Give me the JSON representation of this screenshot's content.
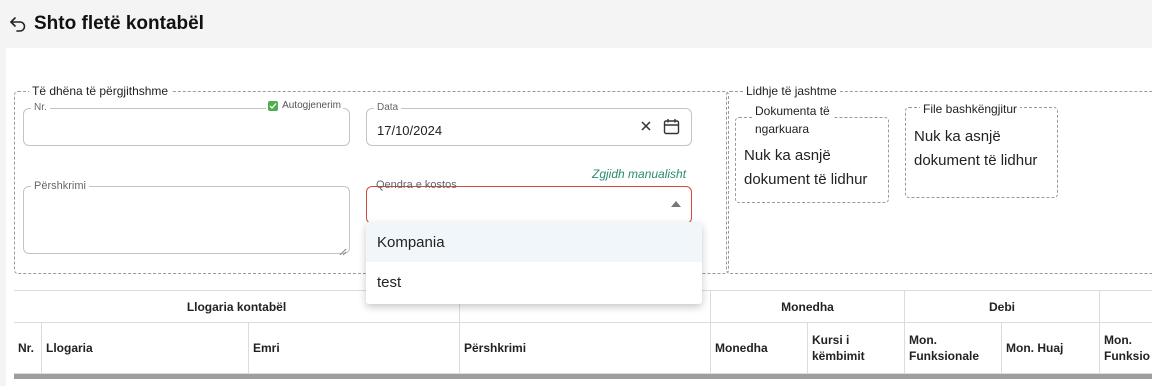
{
  "header": {
    "title": "Shto fletë kontabël",
    "back_icon": "undo-arrow-icon"
  },
  "general": {
    "legend": "Të dhëna të përgjithshme",
    "nr_field": {
      "label": "Nr.",
      "value": "",
      "autogen_label": "Autogjenerim",
      "autogen_checked": true
    },
    "date_field": {
      "label": "Data",
      "value": "17/10/2024"
    },
    "description_field": {
      "label": "Përshkrimi",
      "value": ""
    },
    "cost_center": {
      "label": "Qendra e kostos",
      "value": "",
      "manual_link": "Zgjidh manualisht",
      "options": [
        "Kompania",
        "test"
      ]
    }
  },
  "external": {
    "legend": "Lidhje të jashtme",
    "uploaded_docs": {
      "title_line1": "Dokumenta të",
      "title_line2": "ngarkuara",
      "empty_line1": "Nuk ka asnjë",
      "empty_line2": "dokument të lidhur"
    },
    "attached_files": {
      "title": "File bashkëngjitur",
      "empty_line1": "Nuk ka asnjë",
      "empty_line2": "dokument të lidhur"
    }
  },
  "table": {
    "group_headers": {
      "account": "Llogaria kontabël",
      "currency": "Monedha",
      "debit": "Debi"
    },
    "columns": {
      "nr": "Nr.",
      "account": "Llogaria",
      "name": "Emri",
      "description": "Përshkrimi",
      "currency": "Monedha",
      "rate_line1": "Kursi i",
      "rate_line2": "këmbimit",
      "func_line1": "Mon.",
      "func_line2": "Funksionale",
      "foreign": "Mon. Huaj",
      "credit_func_line1": "Mon.",
      "credit_func_line2": "Funksio"
    }
  },
  "colors": {
    "accent_link": "#2a8a6f",
    "error_border": "#d14a3c",
    "checkbox": "#4caf50"
  }
}
